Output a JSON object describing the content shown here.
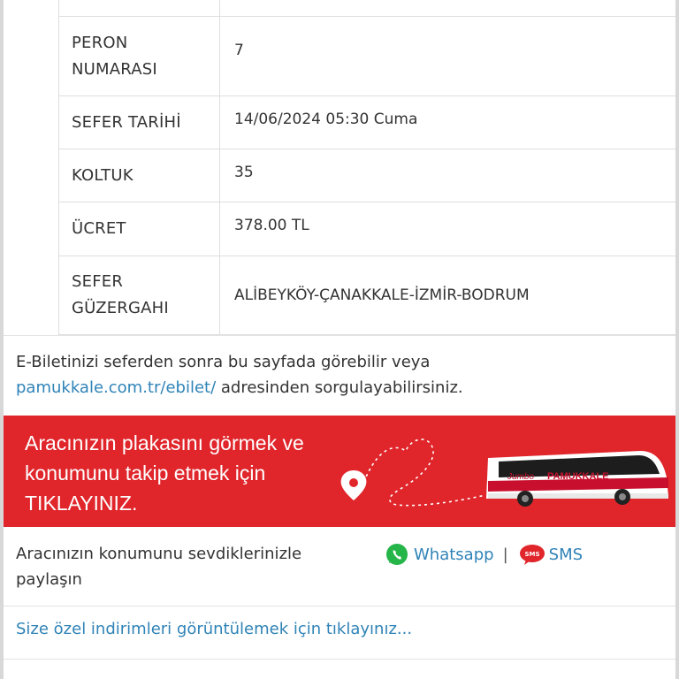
{
  "table": {
    "rows": [
      {
        "label_lines": [
          "PERON",
          "NUMARASI"
        ],
        "value": "7"
      },
      {
        "label_lines": [
          "SEFER TARİHİ"
        ],
        "value": "14/06/2024 05:30 Cuma"
      },
      {
        "label_lines": [
          "KOLTUK"
        ],
        "value": "35"
      },
      {
        "label_lines": [
          "ÜCRET"
        ],
        "value": "378.00 TL"
      },
      {
        "label_lines": [
          "SEFER",
          "GÜZERGAHI"
        ],
        "value": "ALİBEYKÖY-ÇANAKKALE-İZMİR-BODRUM"
      }
    ]
  },
  "info": {
    "text1": "E-Biletinizi seferden sonra bu sayfada görebilir veya",
    "link": "pamukkale.com.tr/ebilet/",
    "text2": " adresinden sorgulayabilirsiniz."
  },
  "banner": {
    "line1": "Aracınızın plakasını görmek ve",
    "line2": "konumunu takip etmek için",
    "line3": "TIKLAYINIZ.",
    "bus_brand": "PAMUKKALE",
    "bus_model": "Jumbo",
    "bg_color": "#e0252b"
  },
  "share": {
    "text_line1": "Aracınızın konumunu sevdiklerinizle",
    "text_line2": "paylaşın",
    "whatsapp_label": "Whatsapp",
    "separator": "|",
    "sms_icon_text": "SMS",
    "sms_label": "SMS"
  },
  "discount": {
    "link": "Size özel indirimleri görüntülemek için tıklayınız..."
  },
  "colors": {
    "link": "#2f83b7",
    "whatsapp": "#25b548",
    "sms": "#e0252b"
  }
}
